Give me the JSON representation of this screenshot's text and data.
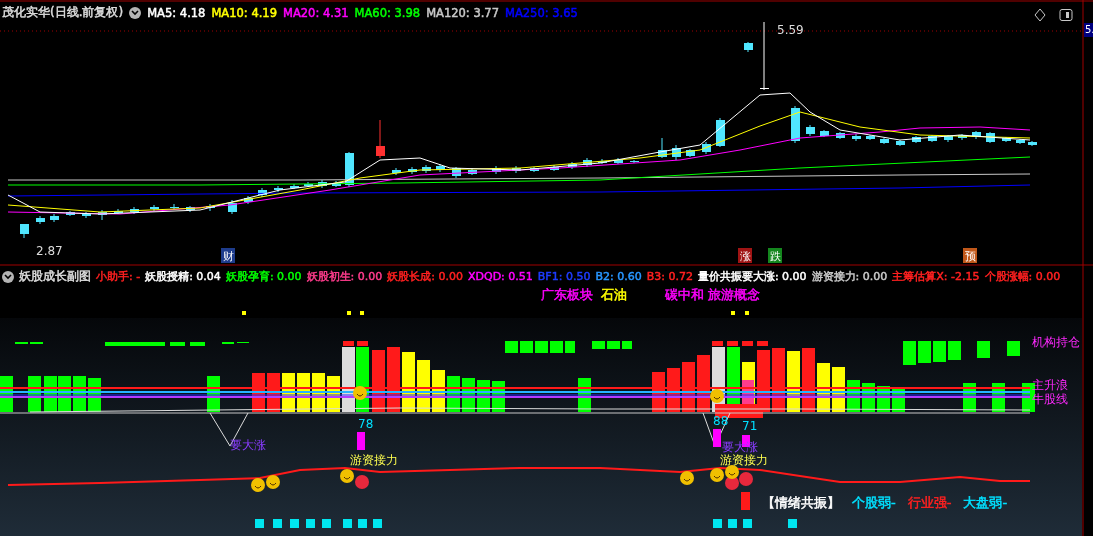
{
  "header": {
    "stock": "茂化实华(日线.前复权)",
    "ma": [
      {
        "label": "MA5: 4.18",
        "color": "#ffffff"
      },
      {
        "label": "MA10: 4.19",
        "color": "#ffff00"
      },
      {
        "label": "MA20: 4.31",
        "color": "#ff00ff"
      },
      {
        "label": "MA60: 3.98",
        "color": "#00ff00"
      },
      {
        "label": "MA120: 3.77",
        "color": "#c8c8c8"
      },
      {
        "label": "MA250: 3.65",
        "color": "#0000ff"
      }
    ]
  },
  "price_chart": {
    "high_label": "5.59",
    "low_label": "2.87",
    "axis_value": "5.",
    "markers": [
      {
        "text": "财",
        "color": "#1e3c8c"
      },
      {
        "text": "涨",
        "color": "#a01414"
      },
      {
        "text": "跌",
        "color": "#14871e"
      },
      {
        "text": "预",
        "color": "#c0581a"
      }
    ]
  },
  "indicator": {
    "title": "妖股成长副图",
    "values": [
      {
        "label": "小助手: -",
        "color": "#ff2020"
      },
      {
        "label": "妖股授精: 0.04",
        "color": "#ffffff"
      },
      {
        "label": "妖股孕育: 0.00",
        "color": "#00ff00"
      },
      {
        "label": "妖股初生: 0.00",
        "color": "#ff3c8c"
      },
      {
        "label": "妖股长成: 0.00",
        "color": "#ff2020"
      },
      {
        "label": "XDQD: 0.51",
        "color": "#ff00ff"
      },
      {
        "label": "BF1: 0.50",
        "color": "#1e3cff"
      },
      {
        "label": "B2: 0.60",
        "color": "#2896ff"
      },
      {
        "label": "B3: 0.72",
        "color": "#ff2020"
      },
      {
        "label": "量价共振要大涨: 0.00",
        "color": "#ffffff"
      },
      {
        "label": "游资接力: 0.00",
        "color": "#c8c8c8"
      },
      {
        "label": "主筹估算X: -2.15",
        "color": "#ff2020"
      },
      {
        "label": "个股涨幅: 0.00",
        "color": "#ff2020"
      }
    ],
    "concepts": [
      {
        "text": "广东板块",
        "color": "#ff00ff"
      },
      {
        "text": "石油",
        "color": "#ffff00"
      },
      {
        "text": "碳中和 旅游概念",
        "color": "#ff00ff"
      }
    ],
    "line_labels": [
      "机构持仓",
      "主升浪",
      "牛股线"
    ],
    "signals": [
      {
        "text": "要大涨",
        "kind": "rise"
      },
      {
        "text": "78",
        "kind": "value"
      },
      {
        "text": "游资接力",
        "kind": "relay"
      },
      {
        "text": "88",
        "kind": "value"
      },
      {
        "text": "71",
        "kind": "value"
      },
      {
        "text": "要大涨",
        "kind": "rise"
      },
      {
        "text": "游资接力",
        "kind": "relay"
      }
    ],
    "resonance": {
      "title": "【情绪共振】",
      "items": [
        {
          "text": "个股弱-",
          "color": "#00e0ff"
        },
        {
          "text": "行业强-",
          "color": "#ff2020"
        },
        {
          "text": "大盘弱-",
          "color": "#00e0ff"
        }
      ]
    }
  }
}
